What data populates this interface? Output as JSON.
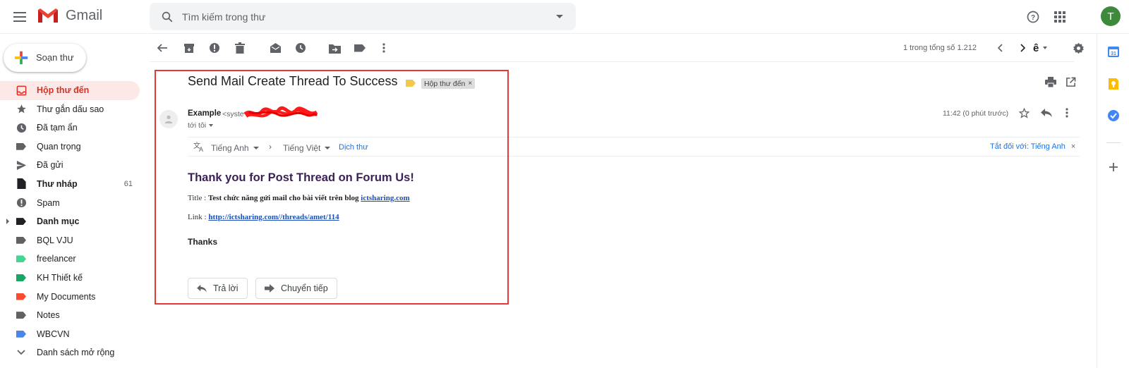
{
  "app": {
    "name": "Gmail"
  },
  "search": {
    "placeholder": "Tìm kiếm trong thư"
  },
  "user": {
    "initial": "T"
  },
  "compose": {
    "label": "Soạn thư"
  },
  "sidebar": {
    "items": [
      {
        "label": "Hộp thư đến",
        "icon": "inbox-icon",
        "active": true
      },
      {
        "label": "Thư gắn dấu sao",
        "icon": "star-icon"
      },
      {
        "label": "Đã tạm ẩn",
        "icon": "clock-icon"
      },
      {
        "label": "Quan trọng",
        "icon": "important-icon"
      },
      {
        "label": "Đã gửi",
        "icon": "send-icon"
      },
      {
        "label": "Thư nháp",
        "icon": "draft-icon",
        "count": "61",
        "bold": true
      },
      {
        "label": "Spam",
        "icon": "spam-icon"
      },
      {
        "label": "Danh mục",
        "icon": "label-icon",
        "bold": true
      },
      {
        "label": "BQL VJU",
        "icon": "label-icon",
        "color": "#616161"
      },
      {
        "label": "freelancer",
        "icon": "label-icon",
        "color": "#42d692"
      },
      {
        "label": "KH Thiết kế",
        "icon": "label-icon",
        "color": "#16a765"
      },
      {
        "label": "My Documents",
        "icon": "label-icon",
        "color": "#fb4c2f"
      },
      {
        "label": "Notes",
        "icon": "label-icon",
        "color": "#616161"
      },
      {
        "label": "WBCVN",
        "icon": "label-icon",
        "color": "#4a86e8"
      },
      {
        "label": "Danh sách mở rộng",
        "icon": "chevron-down-icon"
      }
    ]
  },
  "toolbar": {
    "pager": "1 trong tổng số 1.212",
    "input_tool": "ê"
  },
  "email": {
    "subject": "Send Mail Create Thread To Success",
    "label_chip": "Hộp thư đến",
    "sender_name": "Example",
    "sender_email_partial": "<syste",
    "to": "tới tôi",
    "time": "11:42 (0 phút trước)",
    "translate": {
      "from": "Tiếng Anh",
      "to": "Tiếng Việt",
      "action": "Dịch thư",
      "turn_off": "Tắt đối với: Tiếng Anh"
    },
    "body": {
      "heading": "Thank you for Post Thread on Forum Us!",
      "title_label": "Title :",
      "title_text": "Test chức năng gửi mail cho bài viết trên blog",
      "title_link": "ictsharing.com",
      "link_label": "Link :",
      "link_url": "http://ictsharing.com//threads/amet/114",
      "thanks": "Thanks"
    },
    "reply_label": "Trả lời",
    "forward_label": "Chuyển tiếp"
  },
  "colors": {
    "accent_red": "#d93025",
    "link_blue": "#1a73e8",
    "highlight_border": "#e53935"
  }
}
